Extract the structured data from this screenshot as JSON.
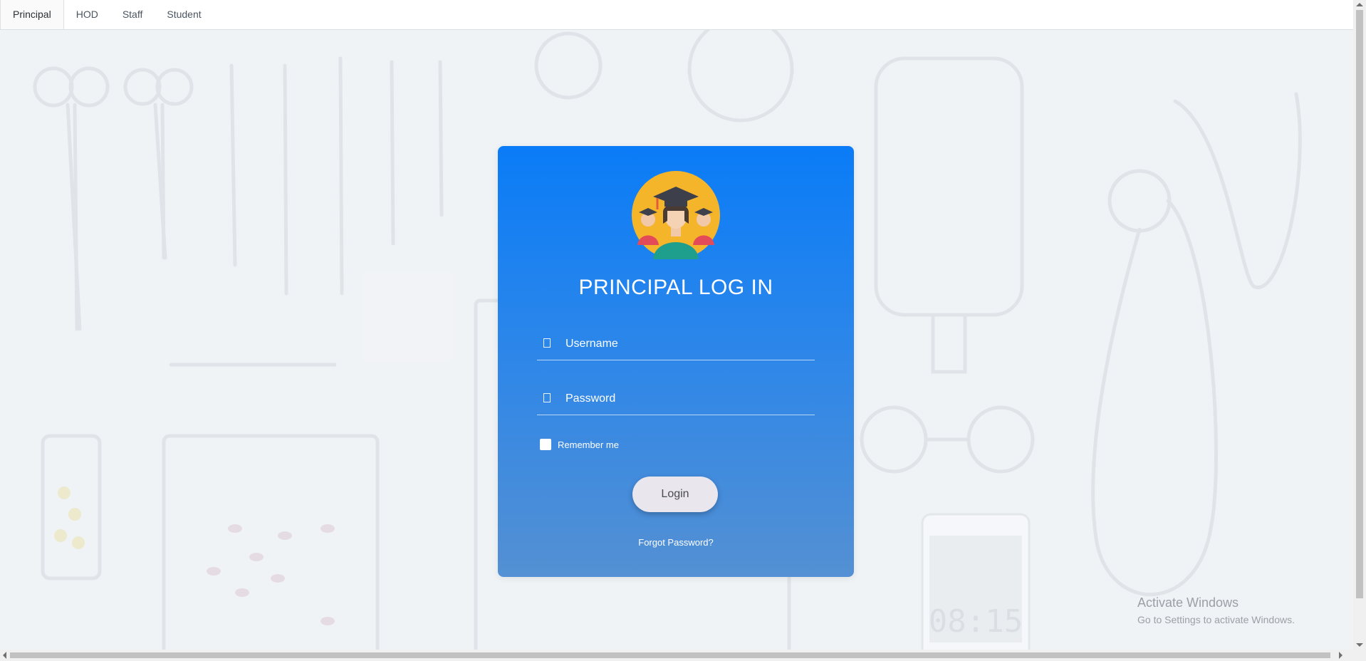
{
  "tabs": [
    {
      "label": "Principal",
      "active": true
    },
    {
      "label": "HOD",
      "active": false
    },
    {
      "label": "Staff",
      "active": false
    },
    {
      "label": "Student",
      "active": false
    }
  ],
  "login": {
    "title": "PRINCIPAL LOG IN",
    "username_placeholder": "Username",
    "password_placeholder": "Password",
    "remember_label": "Remember me",
    "login_label": "Login",
    "forgot_label": "Forgot Password?",
    "avatar_icon": "graduates-avatar-icon"
  },
  "background": {
    "phone_clock": "08:15"
  },
  "watermark": {
    "title": "Activate Windows",
    "subtitle": "Go to Settings to activate Windows."
  },
  "colors": {
    "card_top": "#0a7cf7",
    "card_bottom": "#5490d3",
    "avatar_bg": "#f5b52b"
  }
}
